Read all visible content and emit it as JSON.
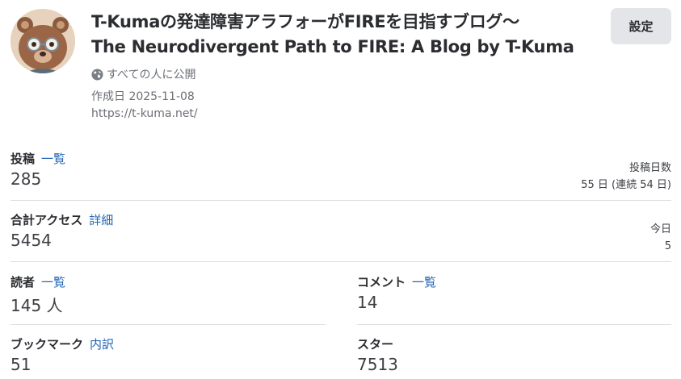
{
  "header": {
    "title_line1": "T-Kumaの発達障害アラフォーがFIREを目指すブログ〜",
    "title_line2": "The Neurodivergent Path to FIRE: A Blog by T-Kuma",
    "settings_label": "設定",
    "visibility": "すべての人に公開",
    "created": "作成日 2025-11-08",
    "url": "https://t-kuma.net/"
  },
  "stats": {
    "posts": {
      "label": "投稿",
      "link": "一覧",
      "value": "285",
      "side_label": "投稿日数",
      "side_value": "55 日 (連続 54 日)"
    },
    "access": {
      "label": "合計アクセス",
      "link": "詳細",
      "value": "5454",
      "side_label": "今日",
      "side_value": "5"
    },
    "readers": {
      "label": "読者",
      "link": "一覧",
      "value": "145 人"
    },
    "comments": {
      "label": "コメント",
      "link": "一覧",
      "value": "14"
    },
    "bookmarks": {
      "label": "ブックマーク",
      "link": "内訳",
      "value": "51"
    },
    "stars": {
      "label": "スター",
      "value": "7513"
    }
  },
  "colors": {
    "link": "#2366b5",
    "button_bg": "#e3e5e8",
    "divider": "#dcdee2"
  },
  "icons": {
    "visibility": "globe-icon",
    "avatar": "bear-avatar"
  }
}
